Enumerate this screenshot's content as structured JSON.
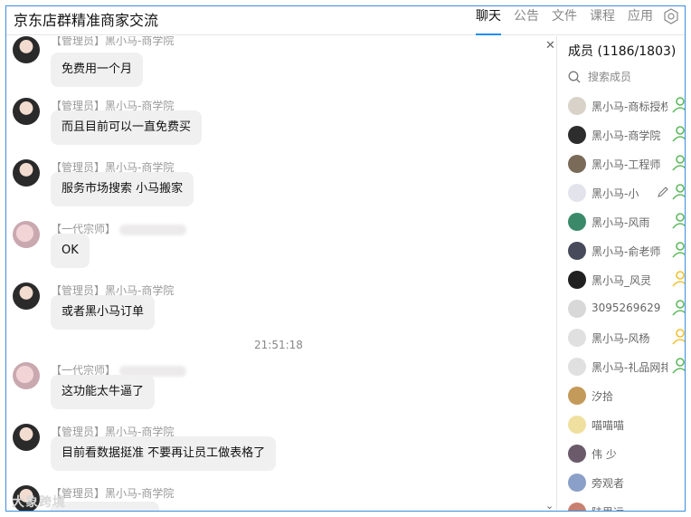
{
  "window": {
    "title": "京东店群精准商家交流"
  },
  "tabs": [
    {
      "label": "聊天",
      "active": true
    },
    {
      "label": "公告",
      "active": false
    },
    {
      "label": "文件",
      "active": false
    },
    {
      "label": "课程",
      "active": false
    },
    {
      "label": "应用",
      "active": false
    }
  ],
  "chat": {
    "messages": [
      {
        "sender": "【管理员】黑小马-商学院",
        "text": "免费用一个月",
        "avatar": "girl"
      },
      {
        "sender": "【管理员】黑小马-商学院",
        "text": "而且目前可以一直免费买",
        "avatar": "girl"
      },
      {
        "sender": "【管理员】黑小马-商学院",
        "text": "服务市场搜索 小马搬家",
        "avatar": "girl"
      },
      {
        "sender": "【一代宗师】",
        "text": "OK",
        "avatar": "pink"
      },
      {
        "sender": "【管理员】黑小马-商学院",
        "text": "或者黑小马订单",
        "avatar": "girl"
      },
      {
        "sender": "【一代宗师】",
        "text": "这功能太牛逼了",
        "avatar": "pink"
      },
      {
        "sender": "【管理员】黑小马-商学院",
        "text": "目前看数据挺准 不要再让员工做表格了",
        "avatar": "girl"
      },
      {
        "sender": "【管理员】黑小马-商学院",
        "text": "",
        "avatar": "girl"
      }
    ],
    "timestamp": "21:51:18",
    "watermark": "大象跨境"
  },
  "members": {
    "title": "成员 (1186/1803)",
    "search_placeholder": "搜索成员",
    "items": [
      {
        "name": "黑小马-商标授权",
        "role": "admin",
        "avatar_color": "#d9d2c8"
      },
      {
        "name": "黑小马-商学院",
        "role": "admin",
        "avatar_color": "#2d2d2d"
      },
      {
        "name": "黑小马-工程师",
        "role": "admin",
        "avatar_color": "#7a6a58"
      },
      {
        "name": "黑小马-小",
        "role": "admin",
        "avatar_color": "#e3e3ec"
      },
      {
        "name": "黑小马-风雨",
        "role": "admin",
        "avatar_color": "#3a8a6a"
      },
      {
        "name": "黑小马-俞老师",
        "role": "admin",
        "avatar_color": "#464a5a"
      },
      {
        "name": "黑小马_风灵",
        "role": "owner",
        "avatar_color": "#202020"
      },
      {
        "name": "3095269629",
        "role": "admin",
        "avatar_color": "#d8d8d8"
      },
      {
        "name": "黑小马-风杨",
        "role": "owner",
        "avatar_color": "#e0e0e0"
      },
      {
        "name": "黑小马-礼品网排",
        "role": "admin",
        "avatar_color": "#e0e0e0"
      },
      {
        "name": "汐拾",
        "role": "",
        "avatar_color": "#c49a5a"
      },
      {
        "name": "喵喵喵",
        "role": "",
        "avatar_color": "#f0e0a0"
      },
      {
        "name": "伟 少",
        "role": "",
        "avatar_color": "#6a5a6a"
      },
      {
        "name": "旁观者",
        "role": "",
        "avatar_color": "#8aa0c8"
      },
      {
        "name": "陆思远",
        "role": "",
        "avatar_color": "#c88070"
      }
    ]
  },
  "colors": {
    "accent": "#1e8ef0",
    "frame": "#3c8ee0",
    "admin_icon": "#5cb85c",
    "owner_icon": "#f0c030"
  }
}
